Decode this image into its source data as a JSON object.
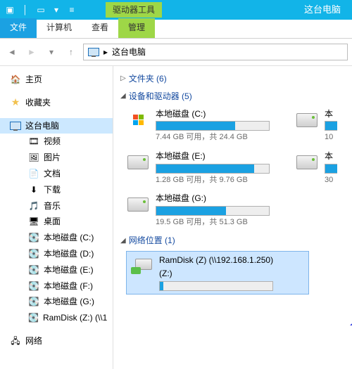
{
  "titlebar": {
    "context_tab": "驱动器工具",
    "window_title": "这台电脑"
  },
  "ribbon": {
    "file": "文件",
    "computer": "计算机",
    "view": "查看",
    "manage": "管理"
  },
  "address": {
    "location": "这台电脑",
    "sep": "▸"
  },
  "sidebar": {
    "home": "主页",
    "favorites": "收藏夹",
    "thispc": "这台电脑",
    "children": [
      {
        "label": "视频"
      },
      {
        "label": "图片"
      },
      {
        "label": "文档"
      },
      {
        "label": "下载"
      },
      {
        "label": "音乐"
      },
      {
        "label": "桌面"
      },
      {
        "label": "本地磁盘 (C:)"
      },
      {
        "label": "本地磁盘 (D:)"
      },
      {
        "label": "本地磁盘 (E:)"
      },
      {
        "label": "本地磁盘 (F:)"
      },
      {
        "label": "本地磁盘 (G:)"
      },
      {
        "label": "RamDisk (Z:) (\\\\1"
      }
    ],
    "network": "网络"
  },
  "groups": {
    "folders": "文件夹 (6)",
    "devices": "设备和驱动器 (5)",
    "netloc": "网络位置 (1)"
  },
  "drives": [
    {
      "name": "本地磁盘 (C:)",
      "sub": "7.44 GB 可用，共 24.4 GB",
      "fill": 70
    },
    {
      "name": "本",
      "sub": "10",
      "fill": 20,
      "cut": true
    },
    {
      "name": "本地磁盘 (E:)",
      "sub": "1.28 GB 可用，共 9.76 GB",
      "fill": 87
    },
    {
      "name": "本",
      "sub": "30",
      "fill": 30,
      "cut": true
    },
    {
      "name": "本地磁盘 (G:)",
      "sub": "19.5 GB 可用，共 51.3 GB",
      "fill": 62
    }
  ],
  "netdrive": {
    "line1": "RamDisk (Z) (\\\\192.168.1.250)",
    "line2": "(Z:)",
    "fill": 3
  }
}
